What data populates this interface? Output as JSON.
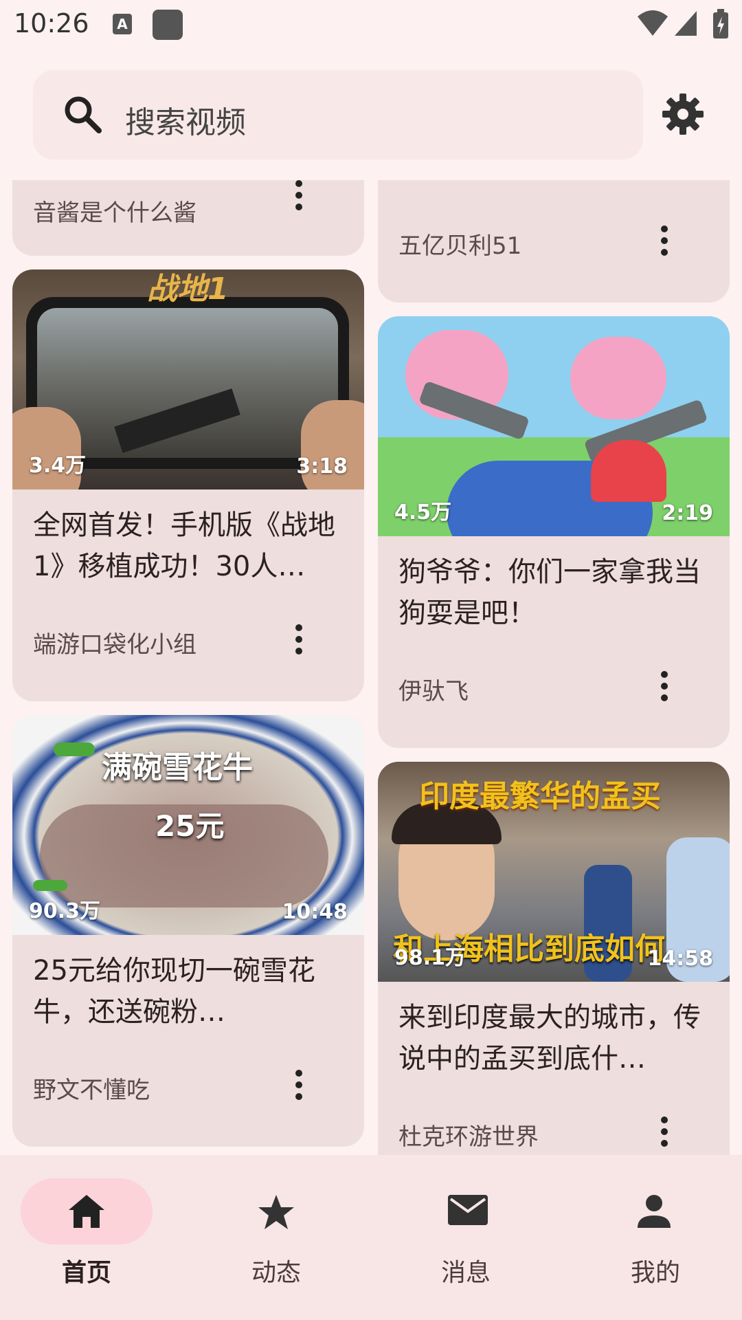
{
  "status": {
    "time": "10:26",
    "a_icon": "A"
  },
  "search": {
    "placeholder": "搜索视频"
  },
  "feed": {
    "left": [
      {
        "title": "",
        "subtitle": "音酱是个什么酱"
      },
      {
        "views": "3.4万",
        "duration": "3:18",
        "title": "全网首发！手机版《战地1》移植成功！30人…",
        "author": "端游口袋化小组",
        "thumb_text": "战地1"
      },
      {
        "views": "90.3万",
        "duration": "10:48",
        "title": "25元给你现切一碗雪花牛，还送碗粉…",
        "author": "野文不懂吃",
        "thumb_text1": "满碗雪花牛",
        "thumb_text2": "25元"
      }
    ],
    "right": [
      {
        "author": "五亿贝利51"
      },
      {
        "views": "4.5万",
        "duration": "2:19",
        "title": "狗爷爷：你们一家拿我当狗耍是吧！",
        "author": "伊驮飞"
      },
      {
        "views": "98.1万",
        "duration": "14:58",
        "title": "来到印度最大的城市，传说中的孟买到底什…",
        "author": "杜克环游世界",
        "thumb_text1": "印度最繁华的孟买",
        "thumb_text2": "和上海相比到底如何"
      }
    ]
  },
  "nav": {
    "items": [
      {
        "label": "首页",
        "icon": "home-icon",
        "active": true
      },
      {
        "label": "动态",
        "icon": "star-icon",
        "active": false
      },
      {
        "label": "消息",
        "icon": "mail-icon",
        "active": false
      },
      {
        "label": "我的",
        "icon": "person-icon",
        "active": false
      }
    ]
  },
  "colors": {
    "background": "#fdf1f1",
    "card": "#efdede",
    "nav": "#f8e5e6",
    "active_pill": "#fbd3d9"
  }
}
